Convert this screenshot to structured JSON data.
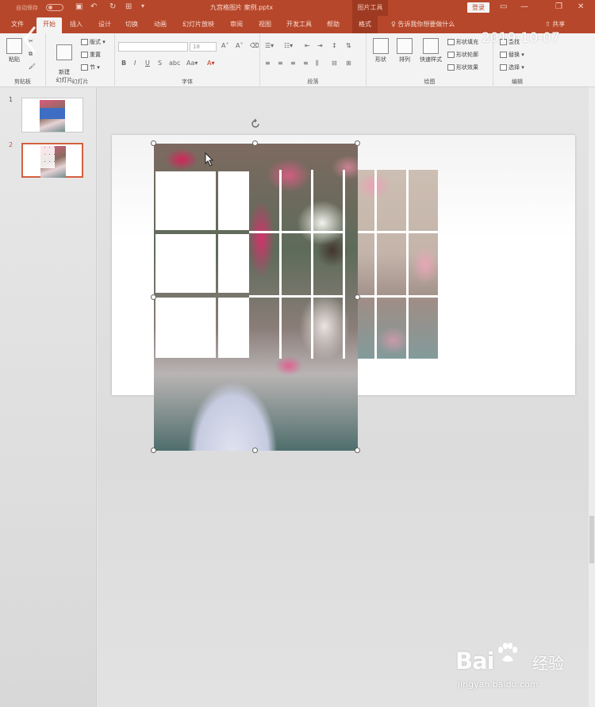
{
  "titlebar": {
    "autosave_label": "自动保存",
    "document_title": "九宫格图片 案例.pptx",
    "context_title": "图片工具",
    "login_label": "登录",
    "date_overlay": "2019-10-07"
  },
  "tabs": [
    {
      "label": "文件"
    },
    {
      "label": "开始"
    },
    {
      "label": "插入"
    },
    {
      "label": "设计"
    },
    {
      "label": "切换"
    },
    {
      "label": "动画"
    },
    {
      "label": "幻灯片放映"
    },
    {
      "label": "审阅"
    },
    {
      "label": "视图"
    },
    {
      "label": "开发工具"
    },
    {
      "label": "帮助"
    },
    {
      "label": "格式"
    }
  ],
  "tellme_label": "告诉我你想要做什么",
  "share_label": "共享",
  "ribbon": {
    "clipboard": {
      "paste": "粘贴",
      "group": "剪贴板"
    },
    "slides": {
      "new_slide": "新建\n幻灯片",
      "layout": "版式",
      "reset": "重置",
      "section": "节",
      "group": "幻灯片"
    },
    "font": {
      "size": "18",
      "group": "字体"
    },
    "paragraph": {
      "group": "段落"
    },
    "drawing": {
      "shape": "形状",
      "arrange": "排列",
      "quick_styles": "快速样式",
      "fill": "形状填充",
      "outline": "形状轮廓",
      "effects": "形状效果",
      "group": "绘图"
    },
    "editing": {
      "find": "查找",
      "replace": "替换",
      "select": "选择",
      "group": "编辑"
    }
  },
  "thumbnails": [
    {
      "number": "1"
    },
    {
      "number": "2"
    }
  ],
  "watermark": {
    "brand": "Bai",
    "brand_suffix": "经验",
    "url": "jingyan.baidu.com"
  },
  "colors": {
    "ribbon_accent": "#b7472a",
    "context_tab": "#9e3a21",
    "selected_thumb": "#d2603c"
  }
}
